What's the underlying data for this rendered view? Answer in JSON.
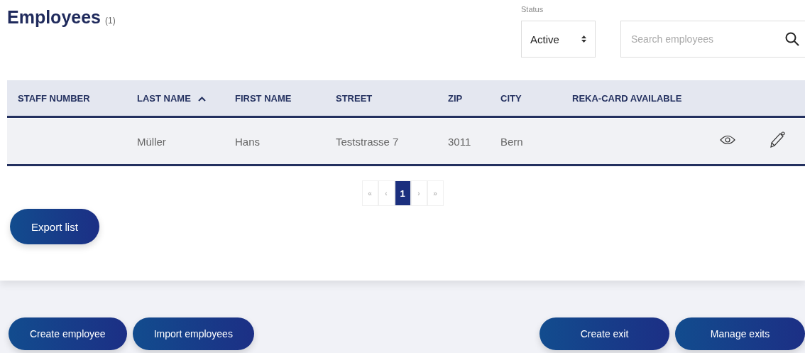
{
  "title": "Employees",
  "count": "(1)",
  "status_filter": {
    "label": "Status",
    "value": "Active"
  },
  "search": {
    "placeholder": "Search employees"
  },
  "table": {
    "columns": [
      {
        "label": "STAFF NUMBER",
        "sorted": false
      },
      {
        "label": "LAST NAME",
        "sorted": true
      },
      {
        "label": "FIRST NAME",
        "sorted": false
      },
      {
        "label": "STREET",
        "sorted": false
      },
      {
        "label": "ZIP",
        "sorted": false
      },
      {
        "label": "CITY",
        "sorted": false
      },
      {
        "label": "REKA-CARD AVAILABLE",
        "sorted": false
      }
    ],
    "rows": [
      {
        "cells": [
          "",
          "Müller",
          "Hans",
          "Teststrasse 7",
          "3011",
          "Bern",
          ""
        ]
      }
    ]
  },
  "pagination": [
    {
      "label": "«",
      "selected": false
    },
    {
      "label": "‹",
      "selected": false
    },
    {
      "label": "1",
      "selected": true
    },
    {
      "label": "›",
      "selected": false
    },
    {
      "label": "»",
      "selected": false
    }
  ],
  "export_button": "Export list",
  "footer_left": [
    "Create employee",
    "Import employees"
  ],
  "footer_right": [
    "Create exit",
    "Manage exits"
  ]
}
